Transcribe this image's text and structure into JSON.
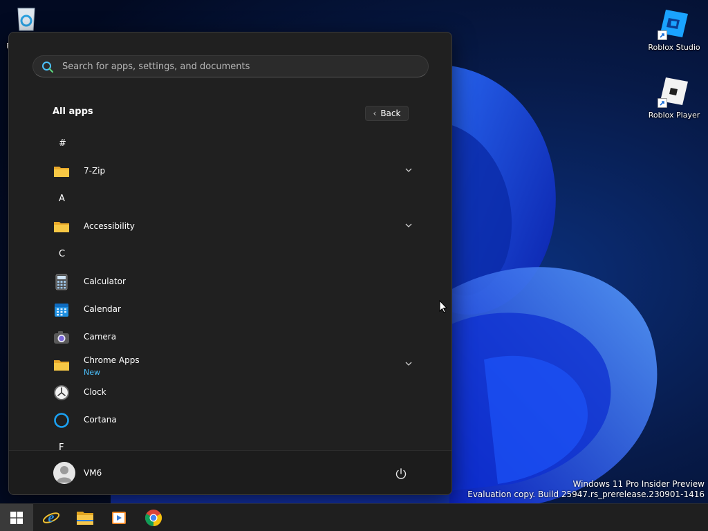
{
  "desktop": {
    "icons": [
      {
        "label": "Roblox Studio",
        "icon": "roblox-studio-icon"
      },
      {
        "label": "Roblox Player",
        "icon": "roblox-player-icon"
      },
      {
        "label": "R",
        "icon": "recycle-bin-icon"
      }
    ],
    "watermark": {
      "line1": "Windows 11 Pro Insider Preview",
      "line2": "Evaluation copy. Build 25947.rs_prerelease.230901-1416"
    }
  },
  "start_menu": {
    "search": {
      "placeholder": "Search for apps, settings, and documents",
      "value": ""
    },
    "title": "All apps",
    "back_label": "Back",
    "sections": [
      {
        "letter": "#",
        "apps": [
          {
            "name": "7-Zip",
            "icon": "folder-icon",
            "expandable": true
          }
        ]
      },
      {
        "letter": "A",
        "apps": [
          {
            "name": "Accessibility",
            "icon": "folder-icon",
            "expandable": true
          }
        ]
      },
      {
        "letter": "C",
        "apps": [
          {
            "name": "Calculator",
            "icon": "calculator-icon"
          },
          {
            "name": "Calendar",
            "icon": "calendar-icon"
          },
          {
            "name": "Camera",
            "icon": "camera-icon"
          },
          {
            "name": "Chrome Apps",
            "subtitle": "New",
            "icon": "folder-icon",
            "expandable": true
          },
          {
            "name": "Clock",
            "icon": "clock-icon"
          },
          {
            "name": "Cortana",
            "icon": "cortana-icon"
          }
        ]
      },
      {
        "letter": "F",
        "apps": []
      }
    ],
    "user": {
      "name": "VM6"
    }
  },
  "taskbar": {
    "items": [
      {
        "icon": "windows-start-icon",
        "active": true
      },
      {
        "icon": "internet-explorer-icon"
      },
      {
        "icon": "file-explorer-icon"
      },
      {
        "icon": "media-player-icon"
      },
      {
        "icon": "chrome-icon"
      }
    ]
  },
  "colors": {
    "accent_blue": "#4cc2ff",
    "menu_bg": "#202020",
    "taskbar_bg": "#1f1f1f",
    "folder_yellow": "#f7c845"
  }
}
